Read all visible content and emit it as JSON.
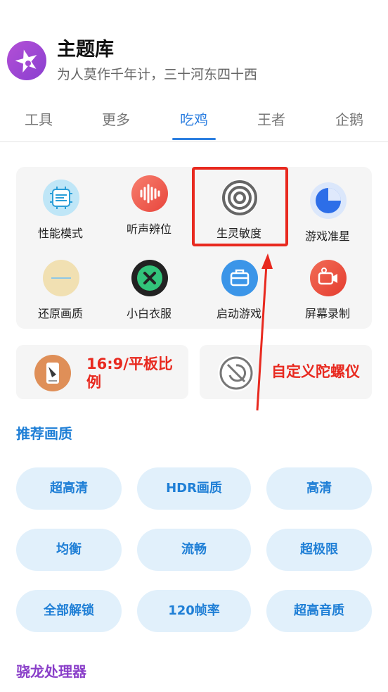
{
  "header": {
    "title": "主题库",
    "subtitle": "为人莫作千年计，三十河东四十西"
  },
  "tabs": [
    "工具",
    "更多",
    "吃鸡",
    "王者",
    "企鹅"
  ],
  "active_tab_index": 2,
  "tools": [
    {
      "label": "性能模式",
      "icon": "cpu-chip-icon"
    },
    {
      "label": "听声辨位",
      "icon": "sound-wave-icon"
    },
    {
      "label": "生灵敏度",
      "icon": "target-icon"
    },
    {
      "label": "游戏准星",
      "icon": "crosshair-icon"
    },
    {
      "label": "还原画质",
      "icon": "restore-icon"
    },
    {
      "label": "小白衣服",
      "icon": "close-circle-icon"
    },
    {
      "label": "启动游戏",
      "icon": "briefcase-icon"
    },
    {
      "label": "屏幕录制",
      "icon": "video-camera-icon"
    }
  ],
  "cards": [
    {
      "label": "16:9/平板比例",
      "icon": "tablet-phone-icon"
    },
    {
      "label": "自定义陀螺仪",
      "icon": "gyroscope-icon"
    }
  ],
  "sections": {
    "recommended": "推荐画质",
    "processor": "骁龙处理器"
  },
  "quality_chips": [
    "超高清",
    "HDR画质",
    "高清",
    "均衡",
    "流畅",
    "超极限",
    "全部解锁",
    "120帧率",
    "超高音质"
  ],
  "colors": {
    "accent_blue": "#2d7fe0",
    "annotation_red": "#e8291f",
    "chip_bg": "#e1f0fb",
    "chip_text": "#1f7fd6",
    "section_recommended": "#1f7fd6",
    "section_processor": "#8a3fc9"
  }
}
